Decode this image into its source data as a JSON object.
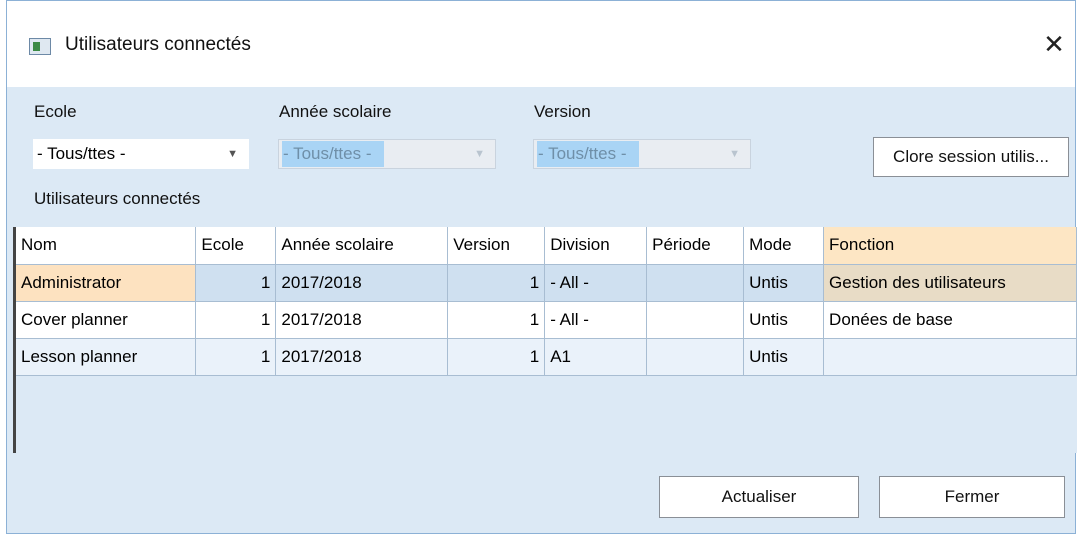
{
  "window": {
    "title": "Utilisateurs connectés"
  },
  "filters": {
    "ecole": {
      "label": "Ecole",
      "value": "- Tous/ttes -"
    },
    "annee": {
      "label": "Année scolaire",
      "value": "- Tous/ttes -"
    },
    "version": {
      "label": "Version",
      "value": "- Tous/ttes -"
    }
  },
  "close_session_label": "Clore session utilis...",
  "section_label": "Utilisateurs connectés",
  "table": {
    "headers": [
      "Nom",
      "Ecole",
      "Année scolaire",
      "Version",
      "Division",
      "Période",
      "Mode",
      "Fonction"
    ],
    "rows": [
      [
        "Administrator",
        "1",
        "2017/2018",
        "1",
        "- All -",
        "",
        "Untis",
        "Gestion des utilisateurs"
      ],
      [
        "Cover planner",
        "1",
        "2017/2018",
        "1",
        "- All -",
        "",
        "Untis",
        "Donées de base"
      ],
      [
        "Lesson planner",
        "1",
        "2017/2018",
        "1",
        "A1",
        "",
        "Untis",
        ""
      ]
    ]
  },
  "buttons": {
    "refresh": "Actualiser",
    "close": "Fermer"
  },
  "colors": {
    "background": "#dce9f5",
    "selection": "#fde2c0",
    "disabled_highlight": "#a9d4f5"
  },
  "icons": {
    "app": "window-icon",
    "close": "close-icon",
    "dropdown": "chevron-down-icon"
  }
}
